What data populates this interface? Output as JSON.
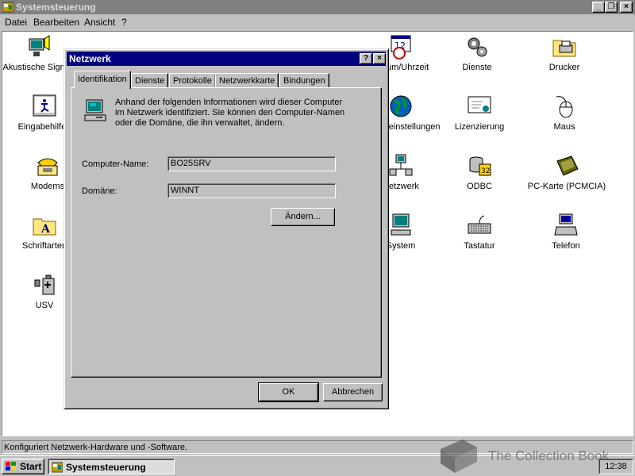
{
  "window": {
    "title": "Systemsteuerung",
    "minimize": "_",
    "restore": "❐",
    "close": "×"
  },
  "menu": {
    "datei": "Datei",
    "bearbeiten": "Bearbeiten",
    "ansicht": "Ansicht",
    "help": "?"
  },
  "icons": {
    "akustische": "Akustische Signale",
    "datum": "Datum/Uhrzeit",
    "dienste": "Dienste",
    "drucker": "Drucker",
    "eingabehilfen": "Eingabehilfen",
    "laendereinstellungen": "Ländereinstellungen",
    "lizenzierung": "Lizenzierung",
    "maus": "Maus",
    "modems": "Modems",
    "netzwerk": "Netzwerk",
    "odbc": "ODBC",
    "pckarte": "PC-Karte (PCMCIA)",
    "schriftarten": "Schriftarten",
    "system": "System",
    "tastatur": "Tastatur",
    "telefon": "Telefon",
    "usv": "USV"
  },
  "dialog": {
    "title": "Netzwerk",
    "help": "?",
    "close": "×",
    "tabs": [
      "Identifikation",
      "Dienste",
      "Protokolle",
      "Netzwerkkarte",
      "Bindungen"
    ],
    "info": "Anhand der folgenden Informationen wird dieser Computer im Netzwerk identifiziert. Sie können den Computer-Namen oder die Domäne, die ihn verwaltet, ändern.",
    "computer_label": "Computer-Name:",
    "computer_value": "BO25SRV",
    "domain_label": "Domäne:",
    "domain_value": "WINNT",
    "change_button": "Ändern...",
    "ok_button": "OK",
    "cancel_button": "Abbrechen"
  },
  "status": "Konfiguriert Netzwerk-Hardware und -Software.",
  "taskbar": {
    "start": "Start",
    "task": "Systemsteuerung",
    "clock": "12:38"
  },
  "watermark": "The Collection Book",
  "colors": {
    "title_active": "#000080",
    "title_inactive": "#808080",
    "face": "#c0c0c0"
  }
}
